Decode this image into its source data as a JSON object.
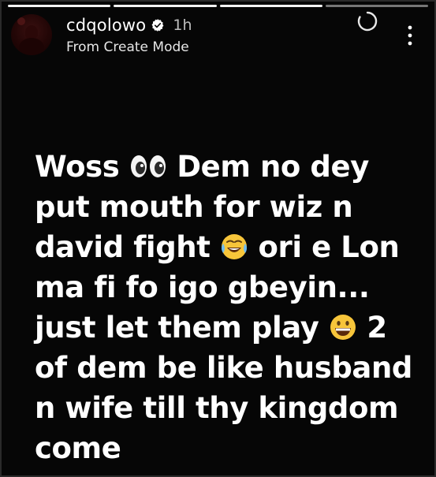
{
  "story": {
    "username": "cdqolowo",
    "time": "1h",
    "source": "From Create Mode",
    "text_lines": [
      {
        "before": "Woss ",
        "emoji": "eyes-emoji",
        "after": " Dem no dey"
      },
      {
        "before": "put mouth for wiz n",
        "emoji": null,
        "after": ""
      },
      {
        "before": "david fight ",
        "emoji": "tears-of-joy-emoji",
        "after": " ori e Lon"
      },
      {
        "before": "ma fi fo igo gbeyin...",
        "emoji": null,
        "after": ""
      },
      {
        "before": "just let them play ",
        "emoji": "grinning-face-emoji",
        "after": " 2"
      },
      {
        "before": "of dem be like husband",
        "emoji": null,
        "after": ""
      },
      {
        "before": "n wife till thy kingdom",
        "emoji": null,
        "after": ""
      },
      {
        "before": "come",
        "emoji": null,
        "after": ""
      }
    ],
    "progress_segments": 4,
    "progress_done": 3
  },
  "icons": {
    "verified": "verified-badge-icon",
    "loading": "loading-spinner-icon",
    "more": "more-options-icon"
  },
  "colors": {
    "background": "#060606",
    "text": "#ffffff",
    "muted": "#bdbdbd",
    "verified_fill": "#ffffff"
  }
}
